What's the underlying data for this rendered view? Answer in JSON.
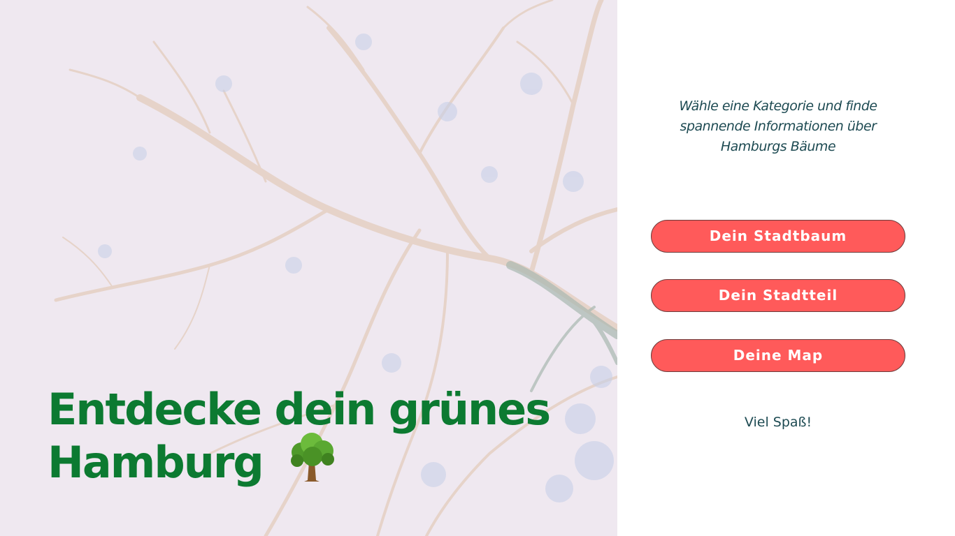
{
  "hero": {
    "title_line1": "Entdecke dein grünes",
    "title_line2": "Hamburg",
    "title_color": "#0c7a31",
    "background_image": "bare-tree-branches-photo",
    "title_icon": "deciduous-tree-emoji-icon"
  },
  "side": {
    "intro": "Wähle eine Kategorie und finde spannende Informationen über Hamburgs Bäume",
    "buttons": [
      {
        "label": "Dein Stadtbaum"
      },
      {
        "label": "Dein Stadtteil"
      },
      {
        "label": "Deine Map"
      }
    ],
    "button_color": "#ff5a5a",
    "outro": "Viel Spaß!"
  }
}
